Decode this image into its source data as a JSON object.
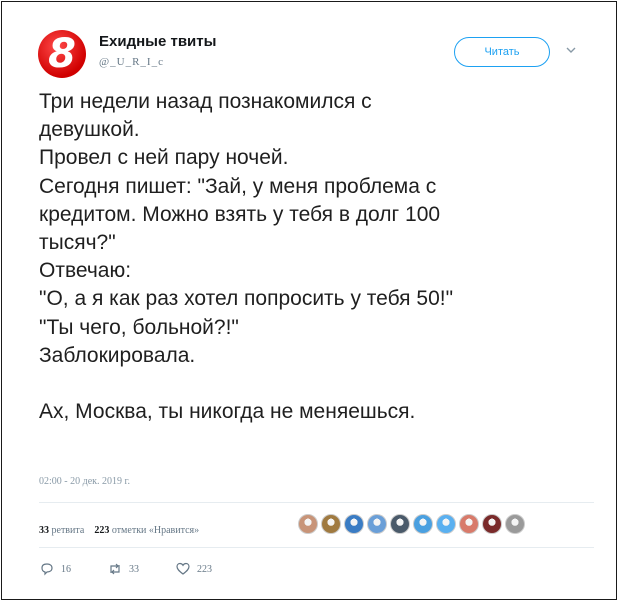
{
  "account": {
    "name": "Ехидные твиты",
    "handle": "@_U_R_I_c",
    "avatar_glyph": "8",
    "avatar_color": "#d00000"
  },
  "follow_label": "Читать",
  "tweet": {
    "lines": [
      "Три недели назад познакомился с",
      "девушкой.",
      "Провел с ней пару ночей.",
      "Сегодня пишет: \"Зай, у меня проблема с",
      "кредитом. Можно взять у тебя в долг 100",
      "тысяч?\"",
      "Отвечаю:",
      "\"О, а я как раз хотел попросить у тебя 50!\"",
      "\"Ты чего, больной?!\"",
      "Заблокировала.",
      "",
      "Ах, Москва, ты никогда не меняешься."
    ],
    "timestamp": "02:00 - 20 дек. 2019 г."
  },
  "stats": {
    "retweets_count": "33",
    "retweets_label": "ретвита",
    "likes_count": "223",
    "likes_label": "отметки «Нравится»"
  },
  "liker_avatars": [
    "#c89478",
    "#a07a40",
    "#3a7cc4",
    "#6a9fd8",
    "#4a5a6a",
    "#4aa0e0",
    "#5ab0f0",
    "#d87a6a",
    "#7a2a2a",
    "#9a9a9a"
  ],
  "actions": {
    "reply_count": "16",
    "retweet_count": "33",
    "like_count": "223"
  },
  "colors": {
    "accent": "#1da1f2",
    "secondary_text": "#657786"
  }
}
